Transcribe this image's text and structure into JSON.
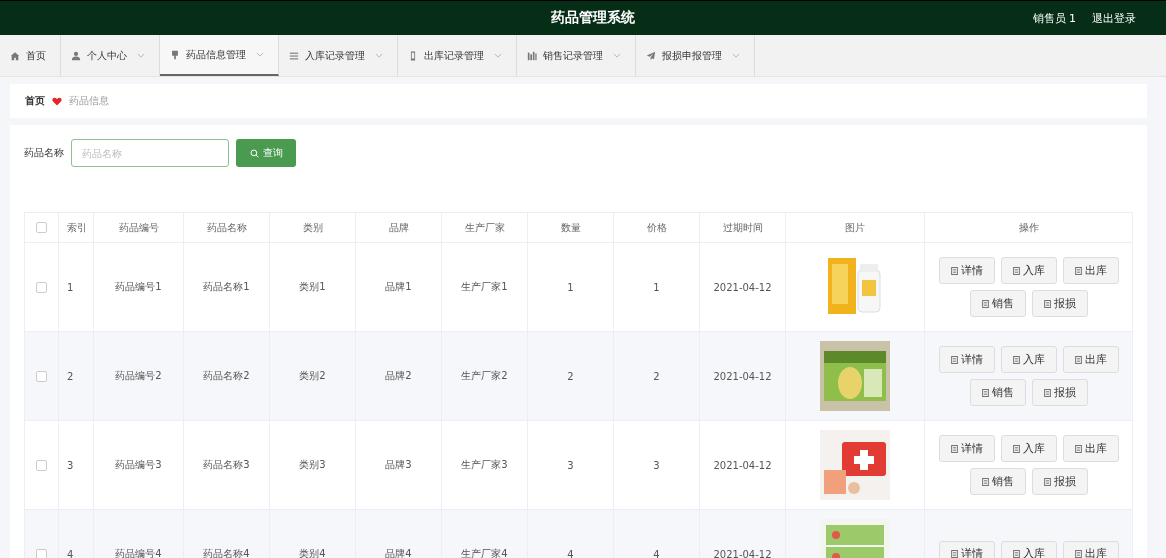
{
  "header": {
    "title": "药品管理系统",
    "user": "销售员 1",
    "logout": "退出登录"
  },
  "nav": [
    {
      "label": "首页",
      "dropdown": false,
      "selected": false
    },
    {
      "label": "个人中心",
      "dropdown": true,
      "selected": false
    },
    {
      "label": "药品信息管理",
      "dropdown": true,
      "selected": true
    },
    {
      "label": "入库记录管理",
      "dropdown": true,
      "selected": false
    },
    {
      "label": "出库记录管理",
      "dropdown": true,
      "selected": false
    },
    {
      "label": "销售记录管理",
      "dropdown": true,
      "selected": false
    },
    {
      "label": "报损申报管理",
      "dropdown": true,
      "selected": false
    }
  ],
  "breadcrumb": [
    "首页",
    "药品信息"
  ],
  "search": {
    "label": "药品名称",
    "placeholder": "药品名称",
    "button": "查询"
  },
  "table": {
    "all_checked": false,
    "columns": [
      "索引",
      "药品编号",
      "药品名称",
      "类别",
      "品牌",
      "生产厂家",
      "数量",
      "价格",
      "过期时间",
      "图片",
      "操作"
    ],
    "rows": [
      {
        "checked": false,
        "cells": [
          "1",
          "药品编号1",
          "药品名称1",
          "类别1",
          "品牌1",
          "生产厂家1",
          "1",
          "1",
          "2021-04-12"
        ],
        "actions": [
          "详情",
          "入库",
          "出库",
          "销售",
          "报损"
        ]
      },
      {
        "checked": false,
        "cells": [
          "2",
          "药品编号2",
          "药品名称2",
          "类别2",
          "品牌2",
          "生产厂家2",
          "2",
          "2",
          "2021-04-12"
        ],
        "actions": [
          "详情",
          "入库",
          "出库",
          "销售",
          "报损"
        ]
      },
      {
        "checked": false,
        "cells": [
          "3",
          "药品编号3",
          "药品名称3",
          "类别3",
          "品牌3",
          "生产厂家3",
          "3",
          "3",
          "2021-04-12"
        ],
        "actions": [
          "详情",
          "入库",
          "出库",
          "销售",
          "报损"
        ]
      },
      {
        "checked": false,
        "cells": [
          "4",
          "药品编号4",
          "药品名称4",
          "类别4",
          "品牌4",
          "生产厂家4",
          "4",
          "4",
          "2021-04-12"
        ],
        "actions": [
          "详情",
          "入库",
          "出库"
        ]
      }
    ]
  }
}
